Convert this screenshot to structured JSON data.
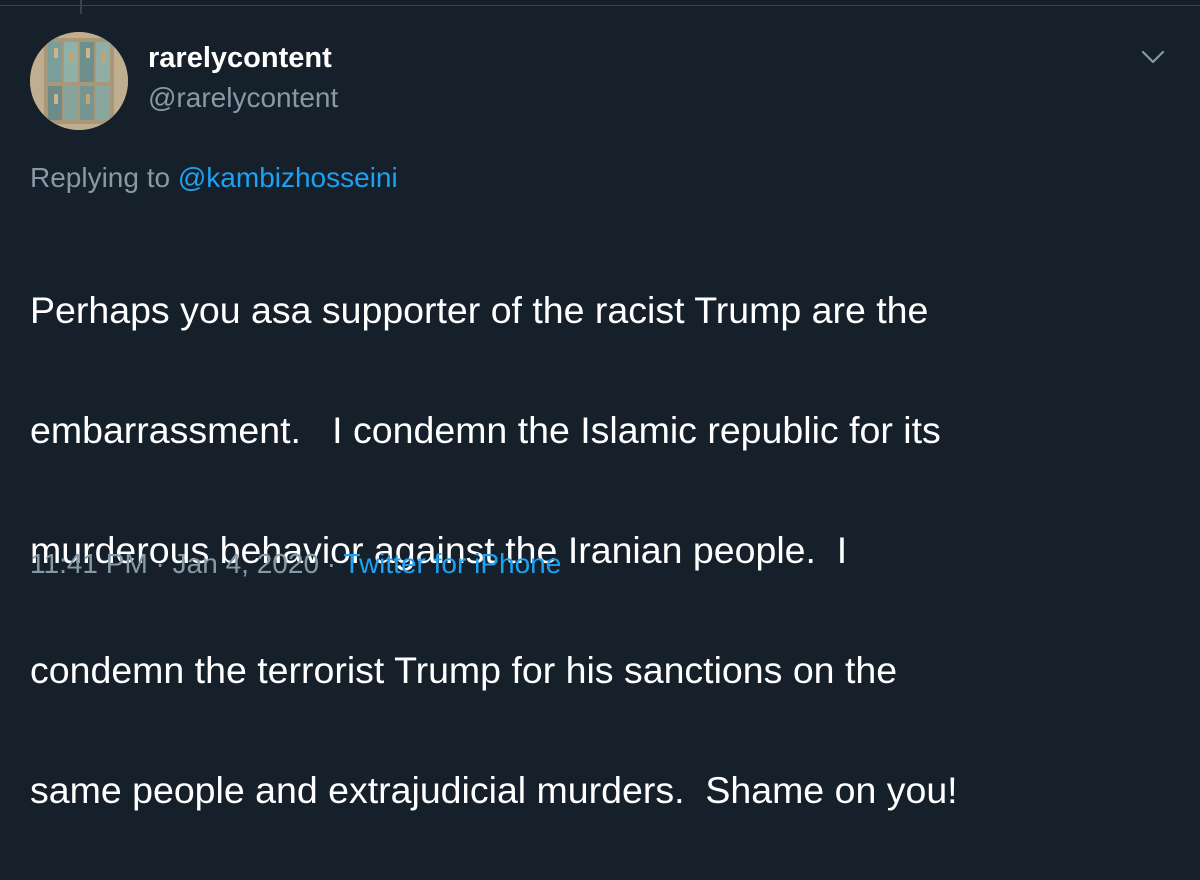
{
  "tweet": {
    "user": {
      "display_name": "rarelycontent",
      "handle": "@rarelycontent",
      "avatar_icon": "stained-glass-avatar"
    },
    "menu_icon": "chevron-down-icon",
    "reply_context": {
      "prefix": "Replying to ",
      "mention": "@kambizhosseini"
    },
    "text_lines": [
      "Perhaps you asa supporter of the racist Trump are the",
      "embarrassment.   I condemn the Islamic republic for its",
      "murderous behavior against the Iranian people.  I",
      "condemn the terrorist Trump for his sanctions on the",
      "same people and extrajudicial murders.  Shame on you!"
    ],
    "meta": {
      "time": "11:41 PM",
      "separator": " · ",
      "date": "Jan 4, 2020",
      "source": "Twitter for iPhone"
    }
  },
  "colors": {
    "background": "#15202b",
    "primary_text": "#ffffff",
    "secondary_text": "#8899a6",
    "accent": "#1da1f2",
    "border": "#38444d"
  }
}
